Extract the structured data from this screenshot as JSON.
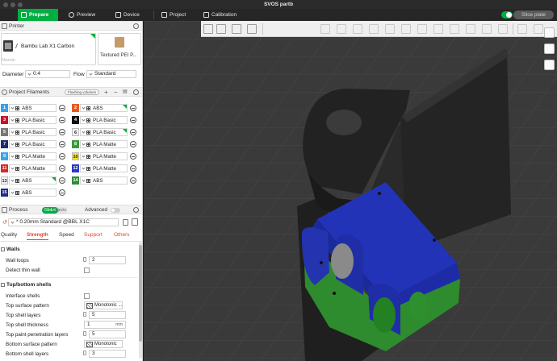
{
  "window": {
    "title": "SVOS partb"
  },
  "topbar": {
    "tabs": [
      {
        "label": "Prepare",
        "icon": "cube-icon"
      },
      {
        "label": "Preview",
        "icon": "eye-icon"
      },
      {
        "label": "Device",
        "icon": "printer-icon"
      },
      {
        "label": "Project",
        "icon": "document-icon"
      },
      {
        "label": "Calibration",
        "icon": "calibration-icon"
      }
    ],
    "slice_button": "Slice plate"
  },
  "printer": {
    "header": "Printer",
    "name": "Bambu Lab X1 Carbon",
    "plate": "Textured PEI P...",
    "nozzle_label": "Nozzle",
    "diameter_label": "Diameter",
    "diameter_value": "0.4",
    "flow_label": "Flow",
    "flow_value": "Standard"
  },
  "filaments": {
    "header": "Project Filaments",
    "flush_button": "Flushing volumes",
    "items": [
      {
        "num": "1",
        "color": "#3aa0e8",
        "name": "ABS",
        "flag": false
      },
      {
        "num": "2",
        "color": "#e85a1a",
        "name": "ABS",
        "flag": true
      },
      {
        "num": "3",
        "color": "#c8102e",
        "name": "PLA Basic",
        "flag": false
      },
      {
        "num": "4",
        "color": "#111111",
        "name": "PLA Basic",
        "flag": false
      },
      {
        "num": "5",
        "color": "#777777",
        "name": "PLA Basic",
        "flag": false
      },
      {
        "num": "6",
        "color": "#f2f2f2",
        "name": "PLA Basic",
        "flag": true
      },
      {
        "num": "7",
        "color": "#1f2b6e",
        "name": "PLA Basic",
        "flag": false
      },
      {
        "num": "8",
        "color": "#3a9a3a",
        "name": "PLA Matte",
        "flag": false
      },
      {
        "num": "9",
        "color": "#3aa6e8",
        "name": "PLA Matte",
        "flag": false
      },
      {
        "num": "10",
        "color": "#f5e514",
        "name": "PLA Matte",
        "flag": false
      },
      {
        "num": "11",
        "color": "#d62828",
        "name": "PLA Matte",
        "flag": false
      },
      {
        "num": "12",
        "color": "#2a36c8",
        "name": "PLA Matte",
        "flag": false
      },
      {
        "num": "13",
        "color": "#f4f4f4",
        "name": "ABS",
        "flag": true
      },
      {
        "num": "14",
        "color": "#2e8b3a",
        "name": "ABS",
        "flag": false
      },
      {
        "num": "15",
        "color": "#1f2b8a",
        "name": "ABS",
        "flag": false
      }
    ]
  },
  "process": {
    "header": "Process",
    "toggle_on": "Global",
    "toggle_off": "Objects",
    "advanced_label": "Advanced",
    "profile": "* 0.20mm Standard @BBL X1C",
    "tabs": [
      "Quality",
      "Strength",
      "Speed",
      "Support",
      "Others"
    ],
    "active_tab": "Strength",
    "walls": {
      "title": "Walls",
      "wall_loops_label": "Wall loops",
      "wall_loops_value": "2",
      "detect_thin_wall_label": "Detect thin wall"
    },
    "top_bottom": {
      "title": "Top/bottom shells",
      "interface_shells_label": "Interface shells",
      "top_surface_pattern_label": "Top surface pattern",
      "top_surface_pattern_value": "Monotonic ...",
      "top_shell_layers_label": "Top shell layers",
      "top_shell_layers_value": "5",
      "top_shell_thickness_label": "Top shell thickness",
      "top_shell_thickness_value": "1",
      "top_shell_thickness_unit": "mm",
      "top_paint_label": "Top paint penetration layers",
      "top_paint_value": "5",
      "bottom_surface_pattern_label": "Bottom surface pattern",
      "bottom_surface_pattern_value": "Monotonic",
      "bottom_shell_layers_label": "Bottom shell layers",
      "bottom_shell_layers_value": "3"
    }
  },
  "colors": {
    "accent": "#00ae42",
    "model_top": "#2233b8",
    "model_bottom": "#2e8b2e",
    "bracket": "#2a2a2a"
  }
}
